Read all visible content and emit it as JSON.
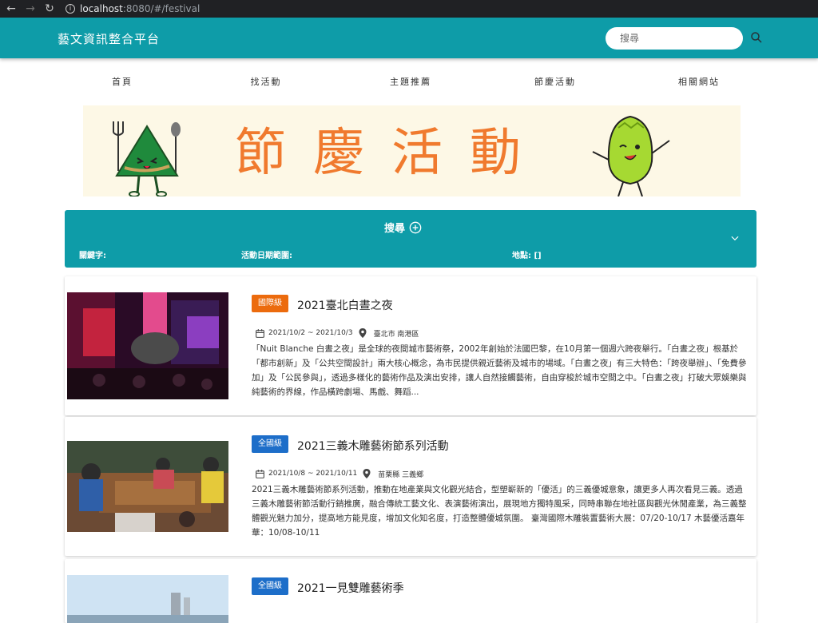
{
  "browser": {
    "url_host": "localhost",
    "url_path": ":8080/#/festival"
  },
  "header": {
    "brand": "藝文資訊整合平台",
    "search_placeholder": "搜尋"
  },
  "nav": [
    "首頁",
    "找活動",
    "主題推薦",
    "節慶活動",
    "相關網站"
  ],
  "banner": {
    "title": "節慶活動"
  },
  "filter": {
    "title": "搜尋",
    "keyword_label": "關鍵字:",
    "date_label": "活動日期範圍:",
    "location_label": "地點: []"
  },
  "events": [
    {
      "badge": "國際級",
      "badge_color": "#ec6b0d",
      "title": "2021臺北白晝之夜",
      "date": "2021/10/2 ~ 2021/10/3",
      "location": "臺北市 南港區",
      "desc": "「Nuit Blanche 白晝之夜」是全球的夜間城市藝術祭，2002年創始於法國巴黎，在10月第一個週六跨夜舉行。「白晝之夜」根基於「都市創新」及「公共空間設計」兩大核心概念，為市民提供親近藝術及城市的場域。「白晝之夜」有三大特色：「跨夜舉辦」、「免費參加」及「公民參與」，透過多樣化的藝術作品及演出安排，讓人自然接觸藝術，自由穿梭於城市空間之中。「白晝之夜」打破大眾娛樂與純藝術的界線，作品橫跨劇場、馬戲、舞蹈..."
    },
    {
      "badge": "全國級",
      "badge_color": "#1d6ec9",
      "title": "2021三義木雕藝術節系列活動",
      "date": "2021/10/8 ~ 2021/10/11",
      "location": "苗栗縣 三義鄉",
      "desc": "2021三義木雕藝術節系列活動，推動在地產業與文化觀光結合，型塑嶄新的「優活」的三義優城意象，讓更多人再次看見三義。透過三義木雕藝術節活動行銷推廣，融合傳統工藝文化、表演藝術演出，展現地方獨特風采，同時串聯在地社區與觀光休閒產業，為三義整體觀光魅力加分，提高地方能見度，增加文化知名度，打造整體優城氛圍。 臺灣國際木雕裝置藝術大展：07/20-10/17 木藝優活嘉年華：10/08-10/11"
    },
    {
      "badge": "全國級",
      "badge_color": "#1d6ec9",
      "title": "2021一見雙雕藝術季"
    }
  ],
  "colors": {
    "primary": "#0e9ca8",
    "banner_bg": "#fdf8e6",
    "banner_text": "#f07a2e"
  }
}
